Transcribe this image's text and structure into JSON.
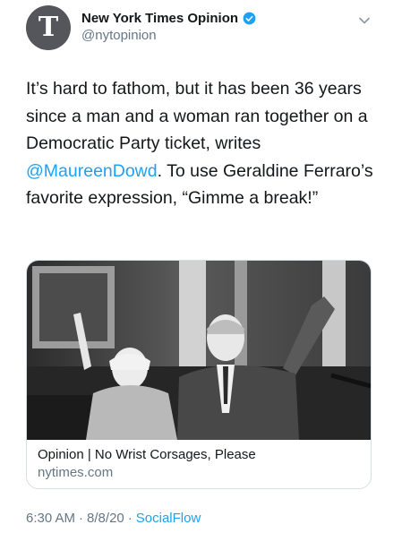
{
  "account": {
    "display_name": "New York Times Opinion",
    "handle": "@nytopinion",
    "avatar_glyph": "T"
  },
  "tweet": {
    "text_before": "It’s hard to fathom, but it has been 36 years since a man and a woman ran together on a Democratic Party ticket, writes ",
    "mention": "@MaureenDowd",
    "text_after": ". To use Geraldine Ferraro’s favorite expression, “Gimme a break!”"
  },
  "card": {
    "title": "Opinion | No Wrist Corsages, Please",
    "domain": "nytimes.com"
  },
  "footer": {
    "time": "6:30 AM",
    "date": "8/8/20",
    "separator": "·",
    "source": "SocialFlow"
  },
  "colors": {
    "link": "#1da1f2",
    "muted": "#657786",
    "text": "#14171a"
  },
  "icons": {
    "verified": "verified-badge-icon",
    "menu": "chevron-down-icon"
  }
}
